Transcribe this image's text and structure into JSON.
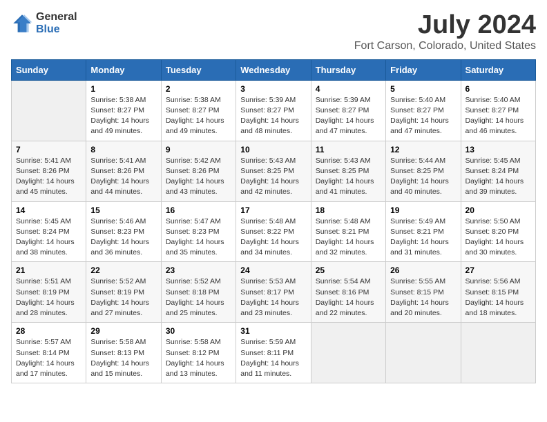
{
  "logo": {
    "general": "General",
    "blue": "Blue"
  },
  "title": {
    "month_year": "July 2024",
    "location": "Fort Carson, Colorado, United States"
  },
  "days_of_week": [
    "Sunday",
    "Monday",
    "Tuesday",
    "Wednesday",
    "Thursday",
    "Friday",
    "Saturday"
  ],
  "weeks": [
    [
      {
        "day": "",
        "info": ""
      },
      {
        "day": "1",
        "info": "Sunrise: 5:38 AM\nSunset: 8:27 PM\nDaylight: 14 hours\nand 49 minutes."
      },
      {
        "day": "2",
        "info": "Sunrise: 5:38 AM\nSunset: 8:27 PM\nDaylight: 14 hours\nand 49 minutes."
      },
      {
        "day": "3",
        "info": "Sunrise: 5:39 AM\nSunset: 8:27 PM\nDaylight: 14 hours\nand 48 minutes."
      },
      {
        "day": "4",
        "info": "Sunrise: 5:39 AM\nSunset: 8:27 PM\nDaylight: 14 hours\nand 47 minutes."
      },
      {
        "day": "5",
        "info": "Sunrise: 5:40 AM\nSunset: 8:27 PM\nDaylight: 14 hours\nand 47 minutes."
      },
      {
        "day": "6",
        "info": "Sunrise: 5:40 AM\nSunset: 8:27 PM\nDaylight: 14 hours\nand 46 minutes."
      }
    ],
    [
      {
        "day": "7",
        "info": "Sunrise: 5:41 AM\nSunset: 8:26 PM\nDaylight: 14 hours\nand 45 minutes."
      },
      {
        "day": "8",
        "info": "Sunrise: 5:41 AM\nSunset: 8:26 PM\nDaylight: 14 hours\nand 44 minutes."
      },
      {
        "day": "9",
        "info": "Sunrise: 5:42 AM\nSunset: 8:26 PM\nDaylight: 14 hours\nand 43 minutes."
      },
      {
        "day": "10",
        "info": "Sunrise: 5:43 AM\nSunset: 8:25 PM\nDaylight: 14 hours\nand 42 minutes."
      },
      {
        "day": "11",
        "info": "Sunrise: 5:43 AM\nSunset: 8:25 PM\nDaylight: 14 hours\nand 41 minutes."
      },
      {
        "day": "12",
        "info": "Sunrise: 5:44 AM\nSunset: 8:25 PM\nDaylight: 14 hours\nand 40 minutes."
      },
      {
        "day": "13",
        "info": "Sunrise: 5:45 AM\nSunset: 8:24 PM\nDaylight: 14 hours\nand 39 minutes."
      }
    ],
    [
      {
        "day": "14",
        "info": "Sunrise: 5:45 AM\nSunset: 8:24 PM\nDaylight: 14 hours\nand 38 minutes."
      },
      {
        "day": "15",
        "info": "Sunrise: 5:46 AM\nSunset: 8:23 PM\nDaylight: 14 hours\nand 36 minutes."
      },
      {
        "day": "16",
        "info": "Sunrise: 5:47 AM\nSunset: 8:23 PM\nDaylight: 14 hours\nand 35 minutes."
      },
      {
        "day": "17",
        "info": "Sunrise: 5:48 AM\nSunset: 8:22 PM\nDaylight: 14 hours\nand 34 minutes."
      },
      {
        "day": "18",
        "info": "Sunrise: 5:48 AM\nSunset: 8:21 PM\nDaylight: 14 hours\nand 32 minutes."
      },
      {
        "day": "19",
        "info": "Sunrise: 5:49 AM\nSunset: 8:21 PM\nDaylight: 14 hours\nand 31 minutes."
      },
      {
        "day": "20",
        "info": "Sunrise: 5:50 AM\nSunset: 8:20 PM\nDaylight: 14 hours\nand 30 minutes."
      }
    ],
    [
      {
        "day": "21",
        "info": "Sunrise: 5:51 AM\nSunset: 8:19 PM\nDaylight: 14 hours\nand 28 minutes."
      },
      {
        "day": "22",
        "info": "Sunrise: 5:52 AM\nSunset: 8:19 PM\nDaylight: 14 hours\nand 27 minutes."
      },
      {
        "day": "23",
        "info": "Sunrise: 5:52 AM\nSunset: 8:18 PM\nDaylight: 14 hours\nand 25 minutes."
      },
      {
        "day": "24",
        "info": "Sunrise: 5:53 AM\nSunset: 8:17 PM\nDaylight: 14 hours\nand 23 minutes."
      },
      {
        "day": "25",
        "info": "Sunrise: 5:54 AM\nSunset: 8:16 PM\nDaylight: 14 hours\nand 22 minutes."
      },
      {
        "day": "26",
        "info": "Sunrise: 5:55 AM\nSunset: 8:15 PM\nDaylight: 14 hours\nand 20 minutes."
      },
      {
        "day": "27",
        "info": "Sunrise: 5:56 AM\nSunset: 8:15 PM\nDaylight: 14 hours\nand 18 minutes."
      }
    ],
    [
      {
        "day": "28",
        "info": "Sunrise: 5:57 AM\nSunset: 8:14 PM\nDaylight: 14 hours\nand 17 minutes."
      },
      {
        "day": "29",
        "info": "Sunrise: 5:58 AM\nSunset: 8:13 PM\nDaylight: 14 hours\nand 15 minutes."
      },
      {
        "day": "30",
        "info": "Sunrise: 5:58 AM\nSunset: 8:12 PM\nDaylight: 14 hours\nand 13 minutes."
      },
      {
        "day": "31",
        "info": "Sunrise: 5:59 AM\nSunset: 8:11 PM\nDaylight: 14 hours\nand 11 minutes."
      },
      {
        "day": "",
        "info": ""
      },
      {
        "day": "",
        "info": ""
      },
      {
        "day": "",
        "info": ""
      }
    ]
  ]
}
